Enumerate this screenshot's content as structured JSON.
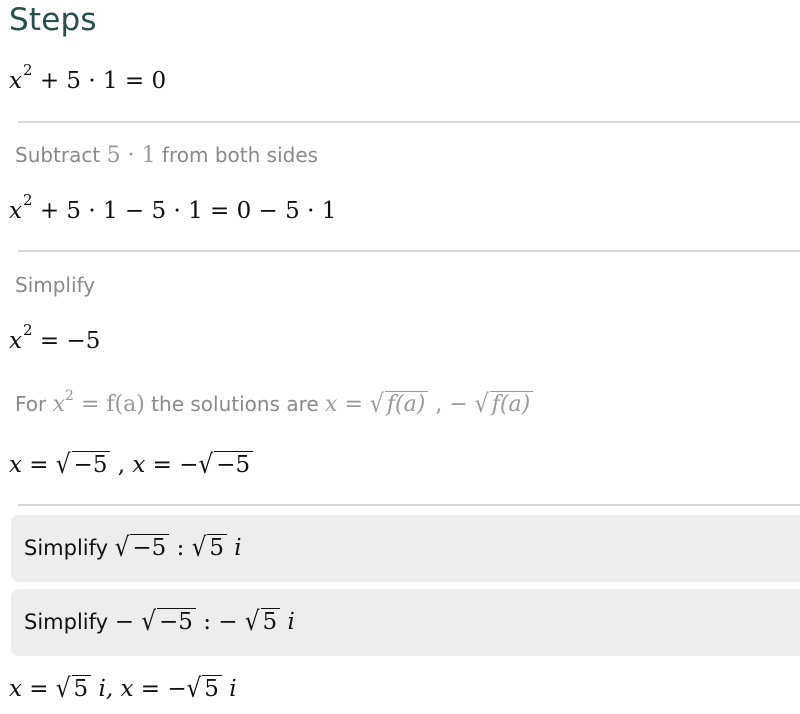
{
  "header": {
    "title": "Steps"
  },
  "colors": {
    "title": "#2b4f4c",
    "separator": "#d9d9d9",
    "panel_background": "#ededed",
    "hint_text": "#8a8a8a"
  },
  "steps": {
    "initial_equation": {
      "base": "x",
      "exponent": "2",
      "rest": " + 5 · 1 = 0"
    },
    "step1": {
      "label_prefix": "Subtract ",
      "label_math": "5 · 1",
      "label_suffix": " from both sides",
      "equation_base": "x",
      "equation_exponent": "2",
      "equation_rest": " + 5 · 1 − 5 · 1 = 0 − 5 · 1"
    },
    "step2": {
      "label": "Simplify",
      "equation_base": "x",
      "equation_exponent": "2",
      "equation_rest": " =  −5"
    },
    "rule": {
      "prefix": "For ",
      "x": "x",
      "exponent": "2",
      "eq_fa": " = f(a)",
      "middle": " the solutions are ",
      "x2": "x",
      "eq": " = ",
      "radicand1": "f(a)",
      "comma": " ,  − ",
      "radicand2": "f(a)"
    },
    "solutions_raw": {
      "x1": "x",
      "eq1": " = ",
      "radicand1": "−5",
      "sep": " , ",
      "x2": "x",
      "eq2": " =  −",
      "radicand2": "−5"
    },
    "simplify_panels": [
      {
        "label": "Simplify ",
        "prefix": "",
        "radicand": "−5",
        "colon": " :   ",
        "result_prefix": "",
        "result_radicand": "5",
        "result_suffix": " i"
      },
      {
        "label": "Simplify ",
        "prefix": " − ",
        "radicand": "−5",
        "colon": " :    ",
        "result_prefix": "− ",
        "result_radicand": "5",
        "result_suffix": " i"
      }
    ],
    "final": {
      "x1": "x",
      "eq1": " = ",
      "radicand1": "5",
      "suffix1": " i, ",
      "x2": "x",
      "eq2": " =  −",
      "radicand2": "5",
      "suffix2": " i"
    }
  }
}
